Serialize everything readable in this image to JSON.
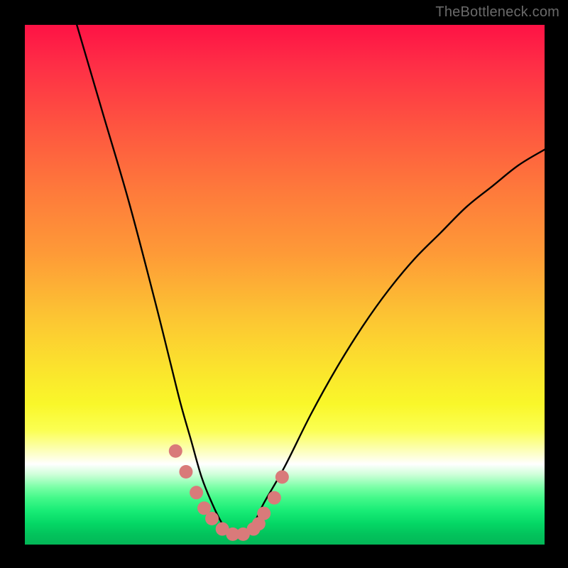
{
  "watermark": {
    "text": "TheBottleneck.com"
  },
  "chart_data": {
    "type": "line",
    "title": "",
    "xlabel": "",
    "ylabel": "",
    "xlim": [
      0,
      100
    ],
    "ylim": [
      0,
      100
    ],
    "grid": false,
    "legend": false,
    "series": [
      {
        "name": "bottleneck-curve",
        "color": "#000000",
        "x": [
          10,
          15,
          20,
          25,
          28,
          30,
          32,
          34,
          36,
          38,
          40,
          42,
          44,
          46,
          50,
          55,
          60,
          65,
          70,
          75,
          80,
          85,
          90,
          95,
          100
        ],
        "values": [
          100,
          83,
          66,
          47,
          35,
          27,
          20,
          13,
          8,
          4,
          2,
          2,
          4,
          8,
          15,
          25,
          34,
          42,
          49,
          55,
          60,
          65,
          69,
          73,
          76
        ]
      }
    ],
    "markers": [
      {
        "name": "highlight-dots",
        "color": "#d97a7a",
        "x": [
          29,
          31,
          33,
          34.5,
          36,
          38,
          40,
          42,
          44,
          45,
          46,
          48,
          49.5
        ],
        "values": [
          18,
          14,
          10,
          7,
          5,
          3,
          2,
          2,
          3,
          4,
          6,
          9,
          13
        ]
      }
    ],
    "background": {
      "type": "vertical-gradient",
      "stops": [
        {
          "pos": 0,
          "color": "#fe1245"
        },
        {
          "pos": 0.3,
          "color": "#fe7a3b"
        },
        {
          "pos": 0.66,
          "color": "#fbe32d"
        },
        {
          "pos": 0.85,
          "color": "#ffffff"
        },
        {
          "pos": 0.9,
          "color": "#44f98a"
        },
        {
          "pos": 1.0,
          "color": "#03b757"
        }
      ]
    }
  }
}
